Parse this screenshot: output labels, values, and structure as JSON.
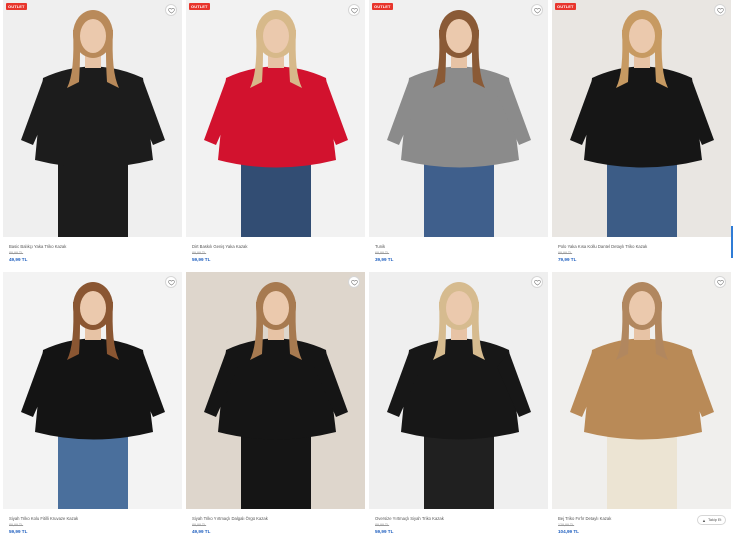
{
  "badge_label": "OUTLET",
  "follow_label": "Takip Et",
  "products": [
    {
      "name": "Basic Balıkçı Yaka Triko Kazak",
      "old_price": "89,99 TL",
      "price": "49,99 TL",
      "badge": true,
      "bg": "#efefef",
      "garment": "#1c1c1c",
      "hair": "#b98a5a",
      "legs": "#1c1c1c"
    },
    {
      "name": "Dirt Baskılı Geniş Yaka Kazak",
      "old_price": "89,99 TL",
      "price": "59,99 TL",
      "badge": true,
      "bg": "#f2f2f2",
      "garment": "#d2122e",
      "hair": "#d7b98a",
      "legs": "#324d73"
    },
    {
      "name": "Tunik",
      "old_price": "69,99 TL",
      "price": "39,99 TL",
      "badge": true,
      "bg": "#f0f0f0",
      "garment": "#8b8b8b",
      "hair": "#8a5a36",
      "legs": "#3f5f8c"
    },
    {
      "name": "Polo Yaka Kısa Kollu Dantel Detaylı Triko Kazak",
      "old_price": "99,99 TL",
      "price": "79,99 TL",
      "badge": true,
      "bg": "#e9e6e2",
      "garment": "#161616",
      "hair": "#c79a62",
      "legs": "#3c5c86"
    },
    {
      "name": "Siyah Triko Kolu Fitilli Kruvaze Kazak",
      "old_price": "89,99 TL",
      "price": "59,99 TL",
      "badge": false,
      "bg": "#f3f3f3",
      "garment": "#141414",
      "hair": "#8a5632",
      "legs": "#4a6f9c"
    },
    {
      "name": "Siyah Triko Yırtmaçlı Dalgalı Örgü Kazak",
      "old_price": "89,99 TL",
      "price": "49,99 TL",
      "badge": false,
      "bg": "#ded6cc",
      "garment": "#151515",
      "hair": "#a77a50",
      "legs": "#151515"
    },
    {
      "name": "Oversize Yırtmaçlı Siyah Triko Kazak",
      "old_price": "89,99 TL",
      "price": "59,99 TL",
      "badge": false,
      "bg": "#efefef",
      "garment": "#171717",
      "hair": "#d6bb8f",
      "legs": "#202020"
    },
    {
      "name": "Bej Triko Fırfır Detaylı Kazak",
      "old_price": "129,99 TL",
      "price": "104,99 TL",
      "badge": false,
      "bg": "#f0efed",
      "garment": "#b98a57",
      "hair": "#b1875f",
      "legs": "#ece4d3"
    }
  ]
}
